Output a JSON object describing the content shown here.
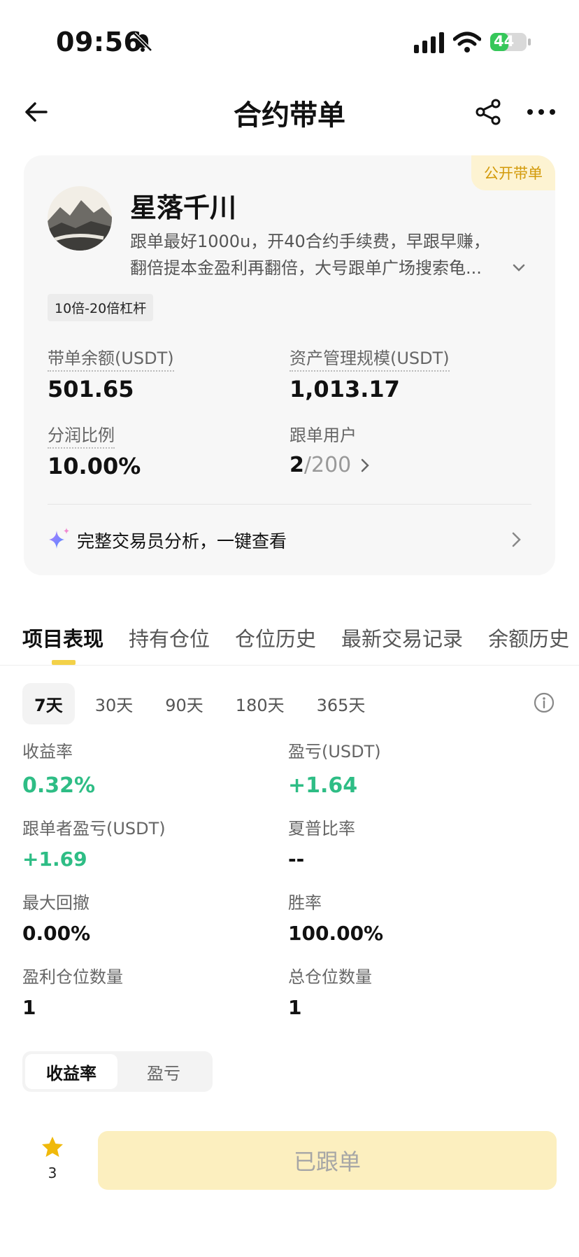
{
  "status_bar": {
    "time": "09:56",
    "battery": "44"
  },
  "nav": {
    "title": "合约带单"
  },
  "trader": {
    "badge": "公开带单",
    "name": "星落千川",
    "bio_line1": "跟单最好1000u，开40合约手续费，早跟早赚，",
    "bio_line2": "翻倍提本金盈利再翻倍，大号跟单广场搜索龟...",
    "leverage_tag": "10倍-20倍杠杆",
    "stats": {
      "balance_label": "带单余额(USDT)",
      "balance_value": "501.65",
      "aum_label": "资产管理规模(USDT)",
      "aum_value": "1,013.17",
      "profit_share_label": "分润比例",
      "profit_share_value": "10.00%",
      "followers_label": "跟单用户",
      "followers_current": "2",
      "followers_max": "/200"
    },
    "analysis_link": "完整交易员分析，一键查看"
  },
  "tabs": [
    "项目表现",
    "持有仓位",
    "仓位历史",
    "最新交易记录",
    "余额历史"
  ],
  "periods": [
    "7天",
    "30天",
    "90天",
    "180天",
    "365天"
  ],
  "metrics": {
    "roi_label": "收益率",
    "roi_value": "0.32%",
    "pnl_label": "盈亏(USDT)",
    "pnl_value": "+1.64",
    "follower_pnl_label": "跟单者盈亏(USDT)",
    "follower_pnl_value": "+1.69",
    "sharpe_label": "夏普比率",
    "sharpe_value": "--",
    "drawdown_label": "最大回撤",
    "drawdown_value": "0.00%",
    "winrate_label": "胜率",
    "winrate_value": "100.00%",
    "profit_positions_label": "盈利仓位数量",
    "profit_positions_value": "1",
    "total_positions_label": "总仓位数量",
    "total_positions_value": "1"
  },
  "chart_toggle": [
    "收益率",
    "盈亏"
  ],
  "bottom": {
    "favorites_count": "3",
    "follow_button": "已跟单"
  },
  "colors": {
    "accent": "#f3d149",
    "positive": "#2ebd85",
    "badge_text": "#d39a0a"
  }
}
